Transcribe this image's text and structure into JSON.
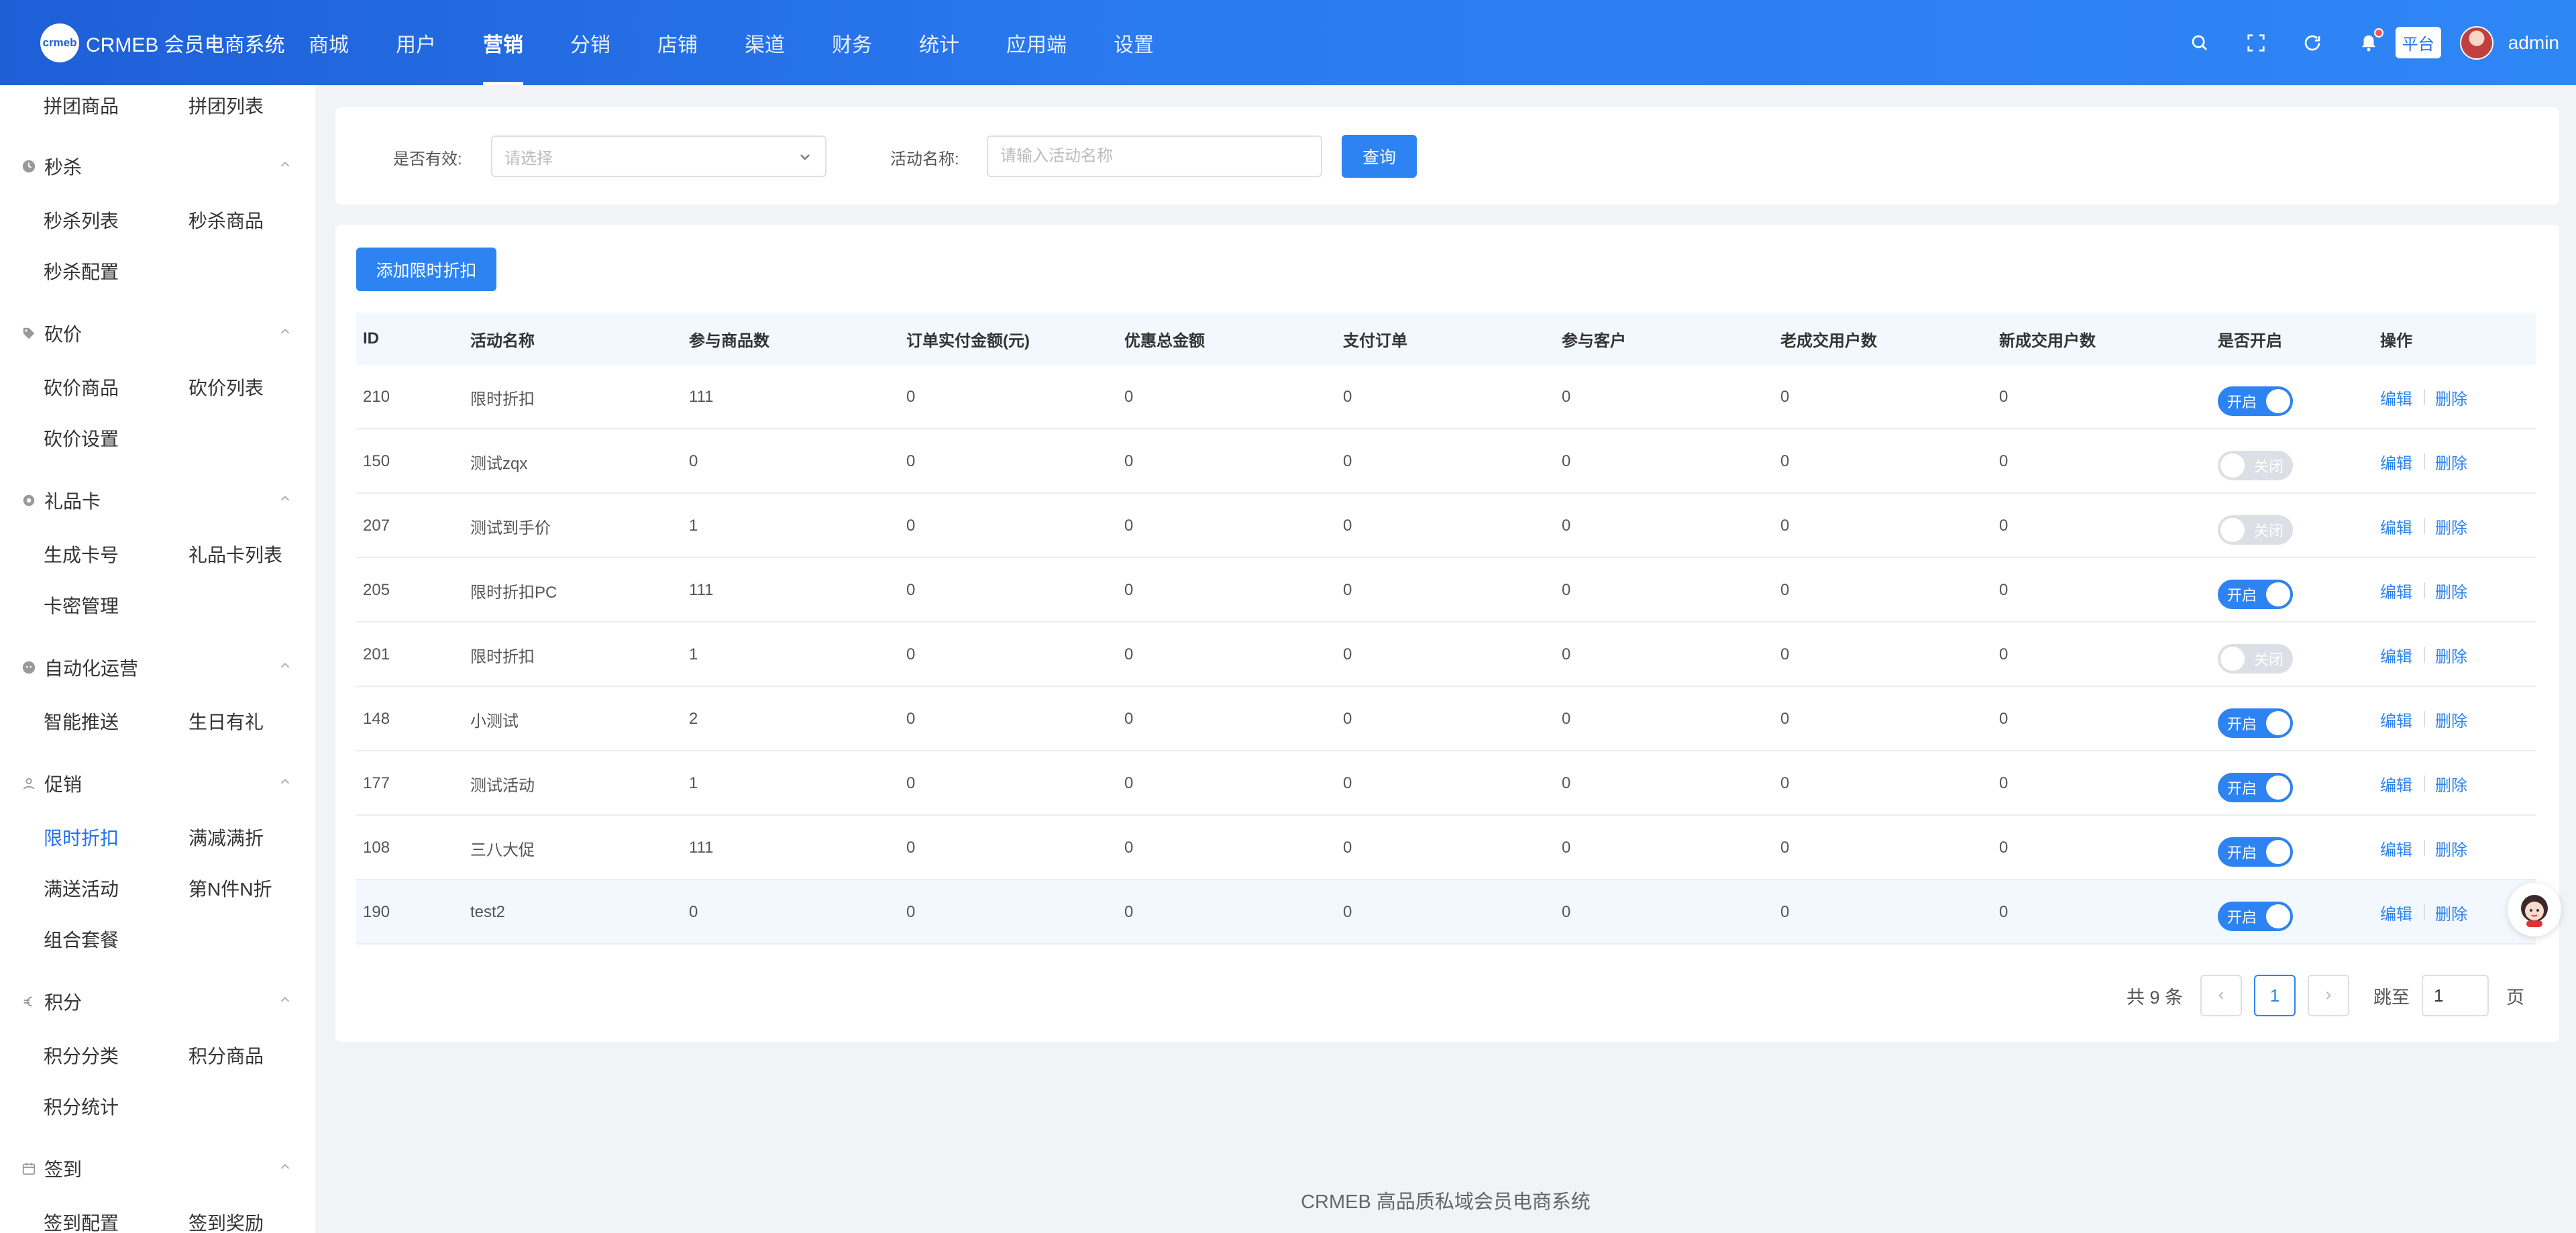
{
  "header": {
    "logo_text": "crmeb",
    "title": "CRMEB 会员电商系统",
    "nav": [
      "商城",
      "用户",
      "营销",
      "分销",
      "店铺",
      "渠道",
      "财务",
      "统计",
      "应用端",
      "设置"
    ],
    "active_nav": 2,
    "platform_tag": "平台",
    "username": "admin"
  },
  "sidebar": {
    "top_items": [
      "拼团商品",
      "拼团列表"
    ],
    "groups": [
      {
        "title": "秒杀",
        "icon": "clock-icon",
        "items": [
          "秒杀列表",
          "秒杀商品",
          "秒杀配置"
        ]
      },
      {
        "title": "砍价",
        "icon": "tag-icon",
        "items": [
          "砍价商品",
          "砍价列表",
          "砍价设置"
        ]
      },
      {
        "title": "礼品卡",
        "icon": "gear-icon",
        "items": [
          "生成卡号",
          "礼品卡列表",
          "卡密管理"
        ]
      },
      {
        "title": "自动化运营",
        "icon": "robot-icon",
        "items": [
          "智能推送",
          "生日有礼"
        ]
      },
      {
        "title": "促销",
        "icon": "person-icon",
        "items": [
          "限时折扣",
          "满减满折",
          "满送活动",
          "第N件N折",
          "组合套餐"
        ]
      },
      {
        "title": "积分",
        "icon": "euro-icon",
        "items": [
          "积分分类",
          "积分商品",
          "积分统计"
        ]
      },
      {
        "title": "签到",
        "icon": "calendar-icon",
        "items": [
          "签到配置",
          "签到奖励"
        ]
      }
    ],
    "active_item": "限时折扣"
  },
  "filter": {
    "valid_label": "是否有效:",
    "valid_placeholder": "请选择",
    "name_label": "活动名称:",
    "name_placeholder": "请输入活动名称",
    "query_button": "查询"
  },
  "add_button": "添加限时折扣",
  "table": {
    "columns": [
      "ID",
      "活动名称",
      "参与商品数",
      "订单实付金额(元)",
      "优惠总金额",
      "支付订单",
      "参与客户",
      "老成交用户数",
      "新成交用户数",
      "是否开启",
      "操作"
    ],
    "on_label": "开启",
    "off_label": "关闭",
    "edit_label": "编辑",
    "delete_label": "删除",
    "rows": [
      {
        "id": "210",
        "name": "限时折扣",
        "products": "111",
        "paid": "0",
        "discount": "0",
        "orders": "0",
        "customers": "0",
        "old_users": "0",
        "new_users": "0",
        "enabled": true
      },
      {
        "id": "150",
        "name": "测试zqx",
        "products": "0",
        "paid": "0",
        "discount": "0",
        "orders": "0",
        "customers": "0",
        "old_users": "0",
        "new_users": "0",
        "enabled": false
      },
      {
        "id": "207",
        "name": "测试到手价",
        "products": "1",
        "paid": "0",
        "discount": "0",
        "orders": "0",
        "customers": "0",
        "old_users": "0",
        "new_users": "0",
        "enabled": false
      },
      {
        "id": "205",
        "name": "限时折扣PC",
        "products": "111",
        "paid": "0",
        "discount": "0",
        "orders": "0",
        "customers": "0",
        "old_users": "0",
        "new_users": "0",
        "enabled": true
      },
      {
        "id": "201",
        "name": "限时折扣",
        "products": "1",
        "paid": "0",
        "discount": "0",
        "orders": "0",
        "customers": "0",
        "old_users": "0",
        "new_users": "0",
        "enabled": false
      },
      {
        "id": "148",
        "name": "小测试",
        "products": "2",
        "paid": "0",
        "discount": "0",
        "orders": "0",
        "customers": "0",
        "old_users": "0",
        "new_users": "0",
        "enabled": true
      },
      {
        "id": "177",
        "name": "测试活动",
        "products": "1",
        "paid": "0",
        "discount": "0",
        "orders": "0",
        "customers": "0",
        "old_users": "0",
        "new_users": "0",
        "enabled": true
      },
      {
        "id": "108",
        "name": "三八大促",
        "products": "111",
        "paid": "0",
        "discount": "0",
        "orders": "0",
        "customers": "0",
        "old_users": "0",
        "new_users": "0",
        "enabled": true
      },
      {
        "id": "190",
        "name": "test2",
        "products": "0",
        "paid": "0",
        "discount": "0",
        "orders": "0",
        "customers": "0",
        "old_users": "0",
        "new_users": "0",
        "enabled": true
      }
    ]
  },
  "pagination": {
    "total_text": "共 9 条",
    "current_page": "1",
    "goto_label": "跳至",
    "goto_value": "1",
    "page_suffix": "页"
  },
  "footer": "CRMEB 高品质私域会员电商系统",
  "colors": {
    "primary": "#2d83f2",
    "header_start": "#1e5fd6",
    "header_end": "#2f86f5"
  }
}
